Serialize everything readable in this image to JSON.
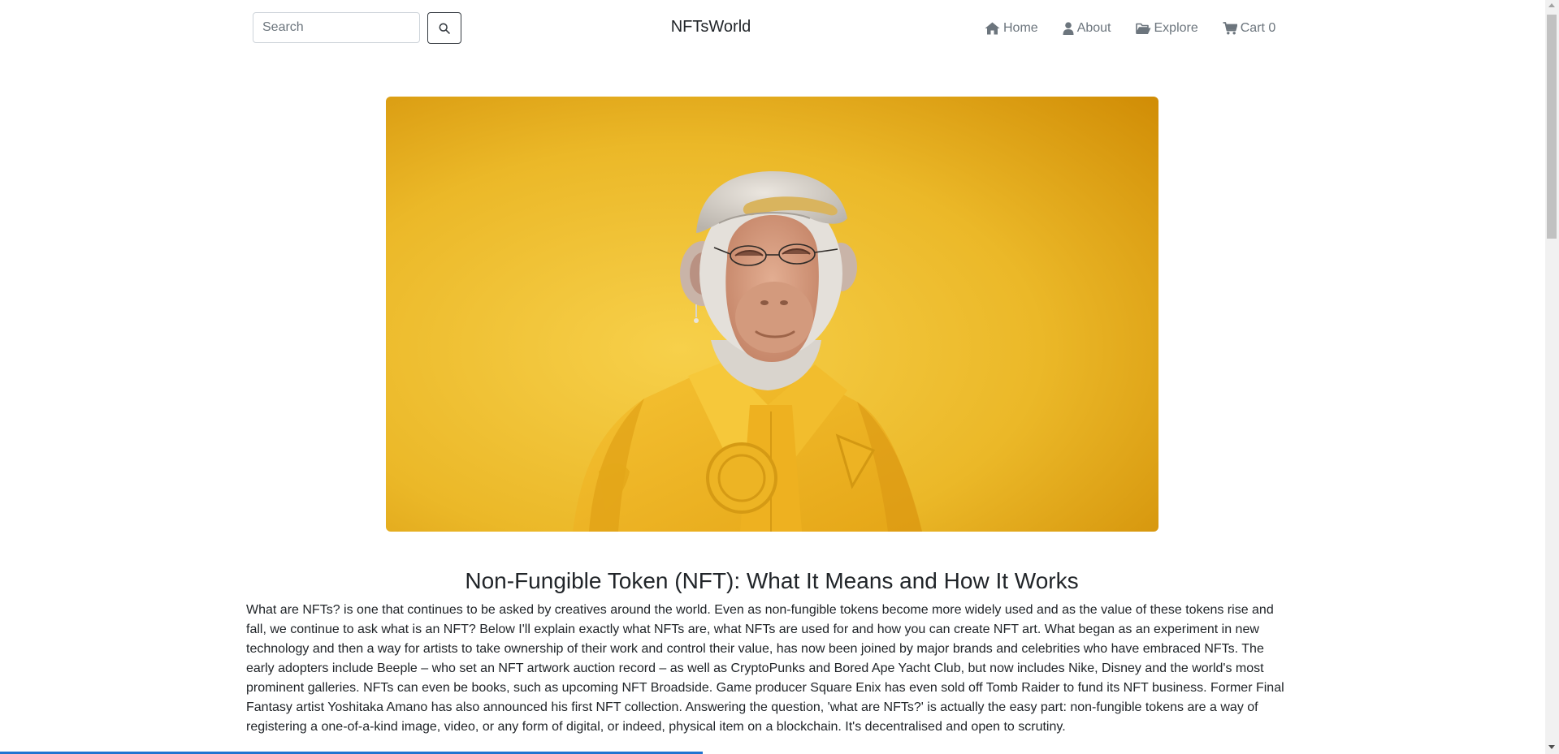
{
  "navbar": {
    "search_placeholder": "Search",
    "brand": "NFTsWorld",
    "links": [
      {
        "label": "Home",
        "icon": "home-icon"
      },
      {
        "label": "About",
        "icon": "user-icon"
      },
      {
        "label": "Explore",
        "icon": "folder-open-icon"
      },
      {
        "label": "Cart 0",
        "icon": "cart-icon"
      }
    ]
  },
  "hero": {
    "image_subject": "3D ape in a yellow jacket and white cap on a yellow background",
    "colors": {
      "background": "#e9b526",
      "jacket": "#f2b824"
    }
  },
  "article": {
    "title": "Non-Fungible Token (NFT): What It Means and How It Works",
    "body": "What are NFTs? is one that continues to be asked by creatives around the world. Even as non-fungible tokens become more widely used and as the value of these tokens rise and fall, we continue to ask what is an NFT? Below I'll explain exactly what NFTs are, what NFTs are used for and how you can create NFT art. What began as an experiment in new technology and then a way for artists to take ownership of their work and control their value, has now been joined by major brands and celebrities who have embraced NFTs. The early adopters include Beeple – who set an NFT artwork auction record – as well as CryptoPunks and Bored Ape Yacht Club, but now includes Nike, Disney and the world's most prominent galleries. NFTs can even be books, such as upcoming NFT Broadside. Game producer Square Enix has even sold off Tomb Raider to fund its NFT business. Former Final Fantasy artist Yoshitaka Amano has also announced his first NFT collection. Answering the question, 'what are NFTs?' is actually the easy part: non-fungible tokens are a way of registering a one-of-a-kind image, video, or any form of digital, or indeed, physical item on a blockchain. It's decentralised and open to scrutiny."
  }
}
